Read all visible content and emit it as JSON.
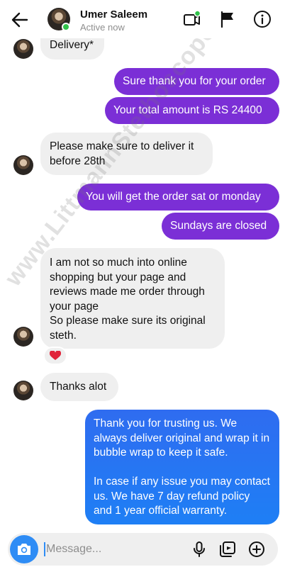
{
  "header": {
    "contact_name": "Umer Saleem",
    "status": "Active now",
    "icons": [
      "back-arrow-icon",
      "video-call-icon",
      "flag-icon",
      "info-icon"
    ],
    "online_color": "#31c24a"
  },
  "messages": {
    "m0": "Delivery*",
    "m1": "Sure thank you for your order",
    "m2": "Your total amount is RS 24400",
    "m3": "Please make sure to deliver it before 28th",
    "m4": "You will get the order sat or monday",
    "m5": "Sundays are closed",
    "m6": "I am not so much into online shopping but your page and reviews made me order through your page\nSo please make sure its original steth.",
    "m7": "Thanks alot",
    "m8": "Thank you for trusting us. We always deliver original and wrap it in bubble wrap to keep it safe.\n\nIn case if any issue you may contact us. We have 7 day refund policy and 1 year official warranty."
  },
  "reaction": "heart",
  "watermark": "www.LittmannStethoscopes.PK",
  "composer": {
    "placeholder": "Message...",
    "icons": [
      "camera-icon",
      "microphone-icon",
      "gallery-icon",
      "plus-icon"
    ]
  },
  "colors": {
    "outgoing_purple": "#7b2fd6",
    "outgoing_blue": "#1e7ff5",
    "incoming_gray": "#efefef",
    "accent": "#2e8cf5"
  }
}
